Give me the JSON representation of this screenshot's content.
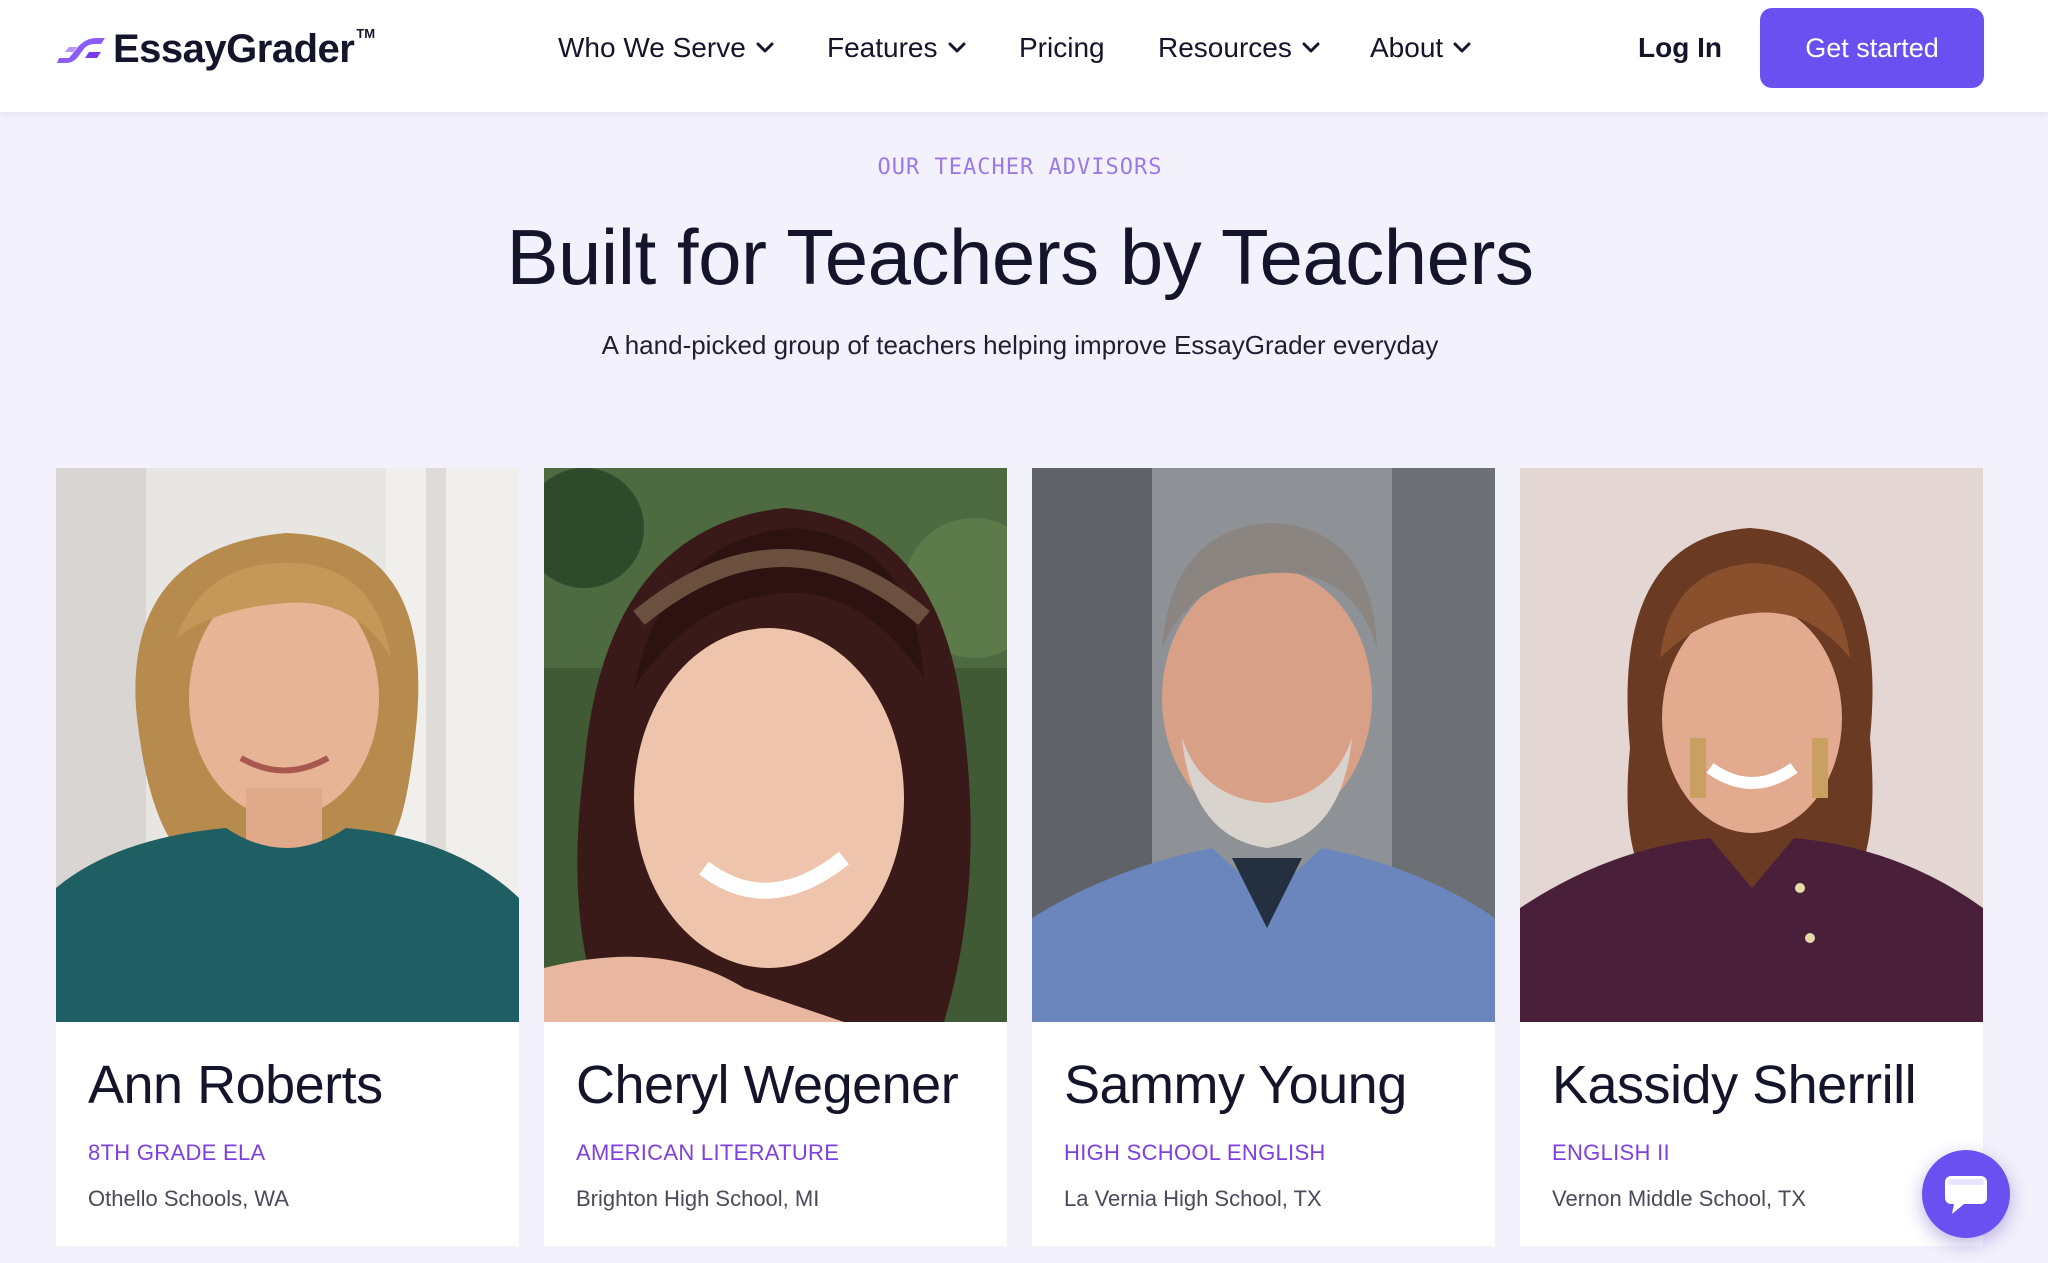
{
  "brand": {
    "name": "EssayGrader",
    "trademark": "TM",
    "accent_color": "#6a50f0",
    "logo_icon": "essaygrader-swoosh-icon"
  },
  "nav": {
    "items": [
      {
        "label": "Who We Serve",
        "has_dropdown": true
      },
      {
        "label": "Features",
        "has_dropdown": true
      },
      {
        "label": "Pricing",
        "has_dropdown": false
      },
      {
        "label": "Resources",
        "has_dropdown": true
      },
      {
        "label": "About",
        "has_dropdown": true
      }
    ],
    "login_label": "Log In",
    "cta_label": "Get started"
  },
  "hero": {
    "eyebrow": "OUR TEACHER ADVISORS",
    "title": "Built for Teachers by Teachers",
    "subtitle": "A hand-picked group of teachers helping improve EssayGrader everyday"
  },
  "advisors": [
    {
      "name": "Ann Roberts",
      "subject": "8TH GRADE ELA",
      "school": "Othello Schools, WA"
    },
    {
      "name": "Cheryl Wegener",
      "subject": "AMERICAN LITERATURE",
      "school": "Brighton High School, MI"
    },
    {
      "name": "Sammy Young",
      "subject": "HIGH SCHOOL ENGLISH",
      "school": "La Vernia High School, TX"
    },
    {
      "name": "Kassidy Sherrill",
      "subject": "ENGLISH II",
      "school": "Vernon Middle School, TX"
    }
  ],
  "chat_widget": {
    "icon": "chat-bubble-icon"
  },
  "colors": {
    "page_background": "#f3f1fc",
    "role_text": "#7d3fe0",
    "eyebrow_text": "#9b7ae6"
  }
}
